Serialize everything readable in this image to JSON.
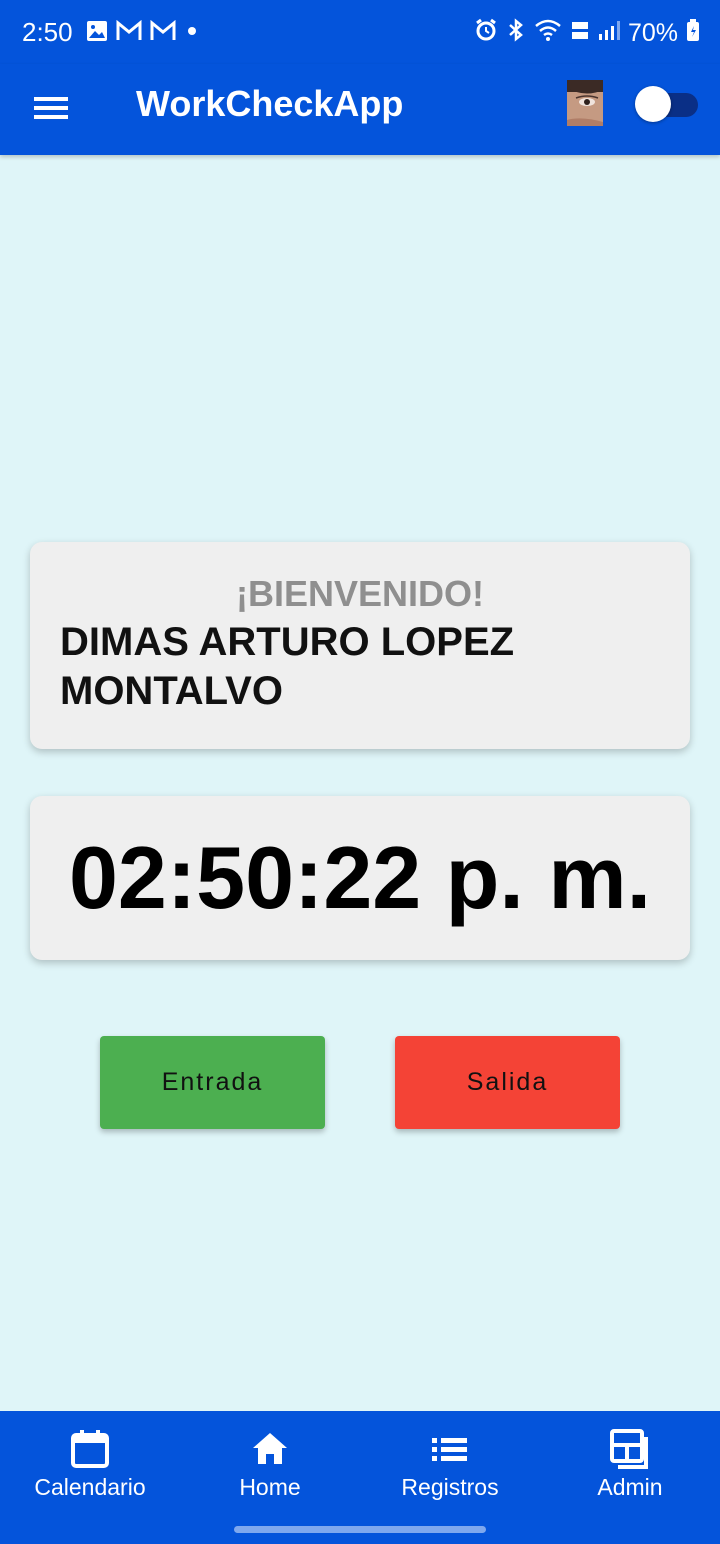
{
  "status_bar": {
    "time": "2:50",
    "battery": "70%"
  },
  "app_bar": {
    "title": "WorkCheckApp"
  },
  "welcome": {
    "greeting": "¡BIENVENIDO!",
    "user_name": "DIMAS ARTURO LOPEZ MONTALVO"
  },
  "clock": {
    "time": "02:50:22 p. m."
  },
  "actions": {
    "entrada": "Entrada",
    "salida": "Salida"
  },
  "bottom_nav": {
    "calendario": "Calendario",
    "home": "Home",
    "registros": "Registros",
    "admin": "Admin"
  },
  "colors": {
    "primary": "#0454db",
    "background": "#dff5f8",
    "card": "#efefef",
    "entrada": "#4caf50",
    "salida": "#f44336",
    "greeting": "#8f8f8f"
  },
  "icons": {
    "status_left": [
      "gallery-icon",
      "gmail-icon",
      "gmail-icon",
      "notification-dot-icon"
    ],
    "status_right": [
      "alarm-icon",
      "bluetooth-icon",
      "wifi-icon",
      "volte-icon",
      "signal-icon",
      "battery-icon"
    ],
    "app_bar": [
      "menu-icon",
      "avatar",
      "theme-toggle"
    ],
    "nav": [
      "calendar-icon",
      "home-icon",
      "list-icon",
      "dashboard-icon"
    ]
  }
}
